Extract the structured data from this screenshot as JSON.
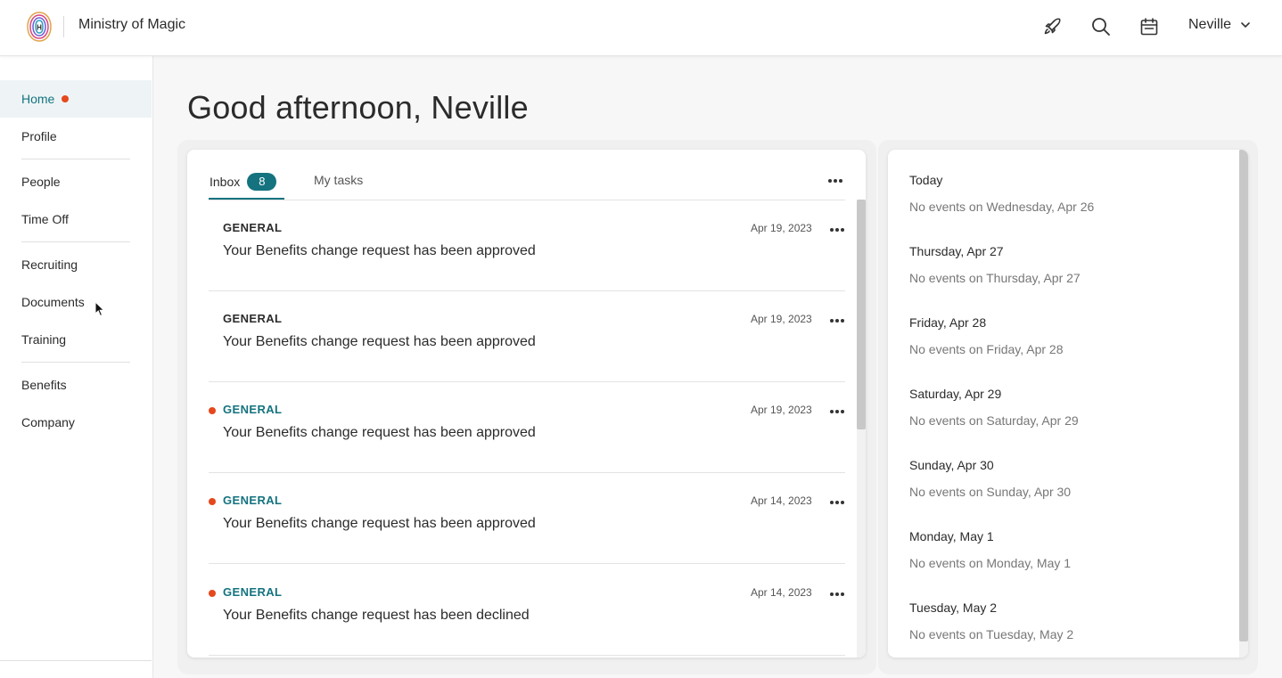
{
  "header": {
    "app_title": "Ministry of Magic",
    "icons": [
      "rocket-icon",
      "search-icon",
      "calendar-icon"
    ],
    "user_name": "Neville"
  },
  "sidebar": {
    "items": [
      {
        "label": "Home",
        "active": true,
        "dot": true
      },
      {
        "label": "Profile"
      },
      {
        "label": "People"
      },
      {
        "label": "Time Off"
      },
      {
        "label": "Recruiting"
      },
      {
        "label": "Documents"
      },
      {
        "label": "Training"
      },
      {
        "label": "Benefits"
      },
      {
        "label": "Company"
      }
    ]
  },
  "greeting": "Good afternoon, Neville",
  "inbox": {
    "tabs": [
      {
        "label": "Inbox",
        "count": "8",
        "active": true
      },
      {
        "label": "My tasks"
      }
    ],
    "items": [
      {
        "category": "GENERAL",
        "title": "Your Benefits change request has been approved",
        "date": "Apr 19, 2023",
        "unread": false
      },
      {
        "category": "GENERAL",
        "title": "Your Benefits change request has been approved",
        "date": "Apr 19, 2023",
        "unread": false
      },
      {
        "category": "GENERAL",
        "title": "Your Benefits change request has been approved",
        "date": "Apr 19, 2023",
        "unread": true
      },
      {
        "category": "GENERAL",
        "title": "Your Benefits change request has been approved",
        "date": "Apr 14, 2023",
        "unread": true
      },
      {
        "category": "GENERAL",
        "title": "Your Benefits change request has been declined",
        "date": "Apr 14, 2023",
        "unread": true
      }
    ]
  },
  "calendar": {
    "days": [
      {
        "heading": "Today",
        "note": "No events on Wednesday, Apr 26"
      },
      {
        "heading": "Thursday, Apr 27",
        "note": "No events on Thursday, Apr 27"
      },
      {
        "heading": "Friday, Apr 28",
        "note": "No events on Friday, Apr 28"
      },
      {
        "heading": "Saturday, Apr 29",
        "note": "No events on Saturday, Apr 29"
      },
      {
        "heading": "Sunday, Apr 30",
        "note": "No events on Sunday, Apr 30"
      },
      {
        "heading": "Monday, May 1",
        "note": "No events on Monday, May 1"
      },
      {
        "heading": "Tuesday, May 2",
        "note": "No events on Tuesday, May 2"
      }
    ]
  },
  "colors": {
    "accent": "#14737f",
    "unread_dot": "#e5481c",
    "active_nav_bg": "#eef4f5"
  }
}
